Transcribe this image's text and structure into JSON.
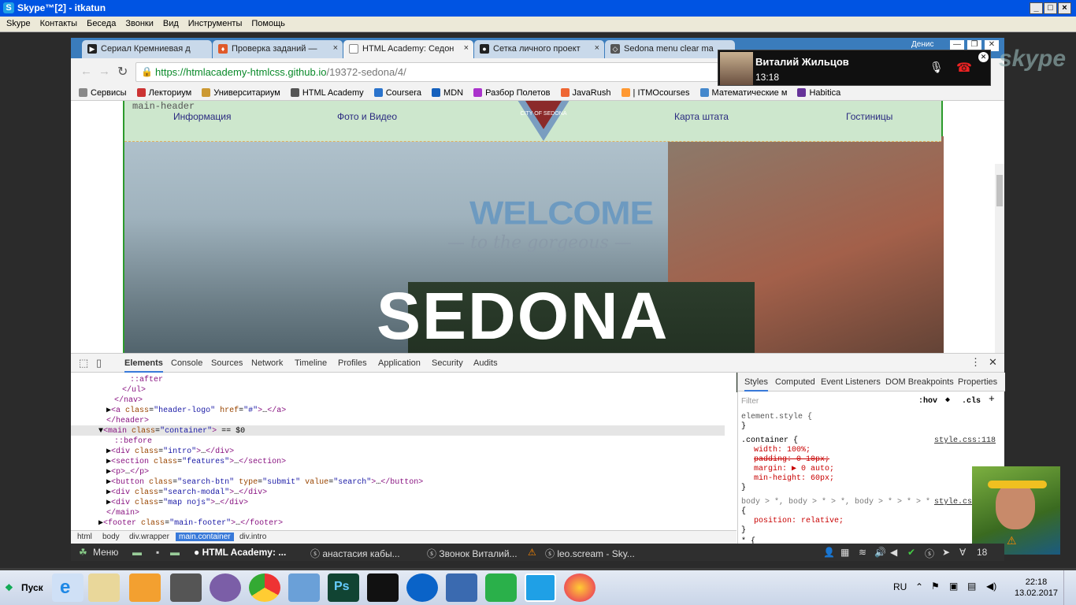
{
  "skype": {
    "title": "Skype™[2] - itkatun",
    "menu": [
      "Skype",
      "Контакты",
      "Беседа",
      "Звонки",
      "Вид",
      "Инструменты",
      "Помощь"
    ]
  },
  "browser": {
    "tabs": [
      "Сериал Кремниевая д",
      "Проверка заданий —",
      "HTML Academy: Седон",
      "Сетка личного проект",
      "Sedona menu clear ma"
    ],
    "user": "Денис",
    "url_host": "https://htmlacademy-htmlcss.github.io",
    "url_path": "/19372-sedona/4/",
    "bookmarks": [
      "Сервисы",
      "Лекториум",
      "Университариум",
      "HTML Academy",
      "Coursera",
      "MDN",
      "Разбор Полетов",
      "JavaRush",
      "| ITMOcourses",
      "Математические м",
      "Habitica"
    ]
  },
  "page": {
    "header_label": "main-header",
    "nav": [
      "Информация",
      "Фото и Видео",
      "Карта штата",
      "Гостиницы"
    ],
    "logo_text": "CITY OF SEDONA",
    "welcome": "WELCOME",
    "tagline": "— to the gorgeous —",
    "title": "SEDONA"
  },
  "devtools": {
    "tabs": [
      "Elements",
      "Console",
      "Sources",
      "Network",
      "Timeline",
      "Profiles",
      "Application",
      "Security",
      "Audits"
    ],
    "crumbs": [
      "html",
      "body",
      "div.wrapper",
      "main.container",
      "div.intro"
    ],
    "styles_tabs": [
      "Styles",
      "Computed",
      "Event Listeners",
      "DOM Breakpoints",
      "Properties"
    ],
    "filter_placeholder": "Filter",
    "hov": ":hov",
    "cls": ".cls",
    "element_style": "element.style {",
    "close_brace": "}",
    "rule1_selector": ".container {",
    "rule1_source": "style.css:118",
    "rule1_props": [
      "width: 100%;",
      "padding: 0 10px;",
      "margin: ▶ 0 auto;",
      "min-height: 60px;"
    ],
    "rule2_selector": "body > *, body > * > *, body > * > * > *",
    "rule2_source": "style.css",
    "rule2_open": "{",
    "rule2_prop": "position: relative;",
    "rule3_start": "* {"
  },
  "call": {
    "name": "Виталий Жильцов",
    "time": "13:18",
    "brand": "skype"
  },
  "panel": {
    "menu": "Меню",
    "tasks": [
      "HTML Academy: ...",
      "анастасия кабы...",
      "Звонок Виталий...",
      "leo.scream - Sky..."
    ],
    "tray_number": "18"
  },
  "taskbar": {
    "start": "Пуск",
    "lang": "RU",
    "time": "22:18",
    "date": "13.02.2017"
  }
}
